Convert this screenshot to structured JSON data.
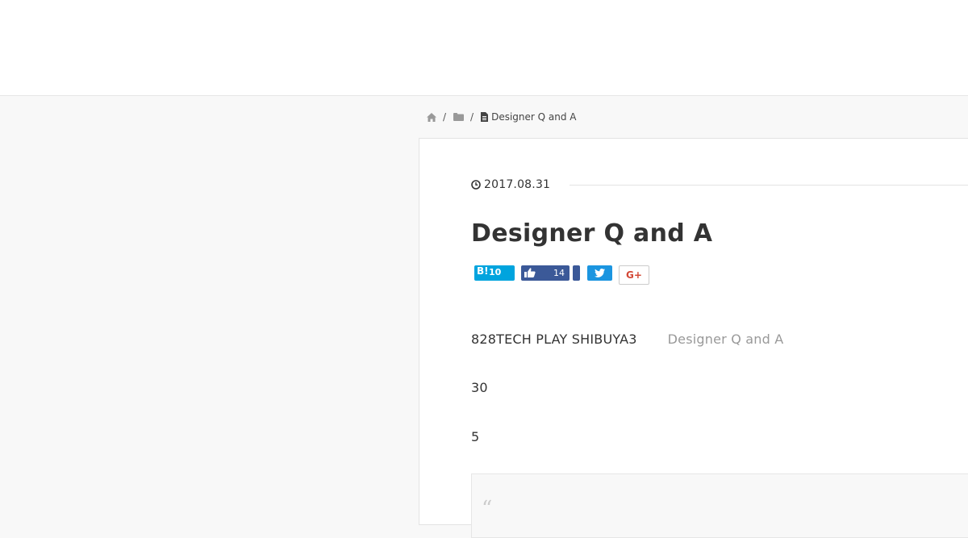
{
  "breadcrumb": {
    "icons": [
      "home-icon",
      "folder-icon",
      "file-icon"
    ],
    "separator": "/",
    "current": "Designer Q and A"
  },
  "article": {
    "date_icon": "clock-icon",
    "date": "2017.08.31",
    "title": "Designer Q and A",
    "share": {
      "hatena_label": "B!",
      "hatena_count": "10",
      "facebook_count": "14",
      "twitter_icon": "twitter-icon",
      "gplus_label": "G+"
    },
    "paragraphs": [
      {
        "text": "828TECH PLAY SHIBUYA3",
        "muted": "Designer Q and A"
      },
      {
        "text": "30"
      },
      {
        "text": "5"
      }
    ],
    "quote_mark": "“"
  },
  "colors": {
    "hatena": "#00a4de",
    "facebook": "#3b5998",
    "twitter": "#1b95e0",
    "gplus": "#d34836",
    "page_bg": "#f8f8f8"
  }
}
